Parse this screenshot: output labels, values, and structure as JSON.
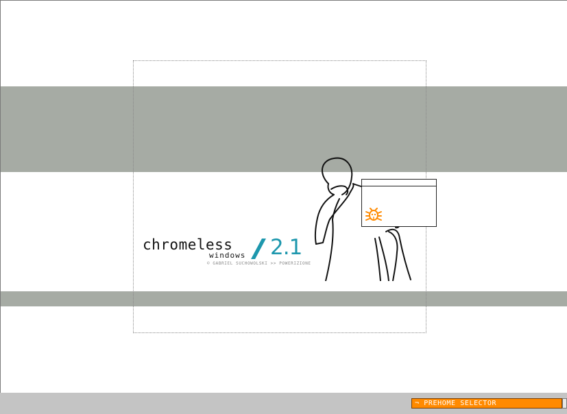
{
  "logo": {
    "title": "chromeless",
    "subtitle": "windows",
    "version": "2.1",
    "credits": "© GABRIEL SUCHOWOLSKI >> POWERIZIONE",
    "accent_color": "#1d97ad"
  },
  "illustration": {
    "figure_icon": "person-sneezing-illustration",
    "window_icon": "window-icon",
    "bug_icon": "bug-icon",
    "bug_color": "#ff8a00"
  },
  "bottom_bar": {
    "selector_value": "¬ PREHOME SELECTOR",
    "selector_color": "#ff8a00"
  },
  "colors": {
    "band": "#a6aba4",
    "bottom_bar": "#c4c4c4"
  }
}
